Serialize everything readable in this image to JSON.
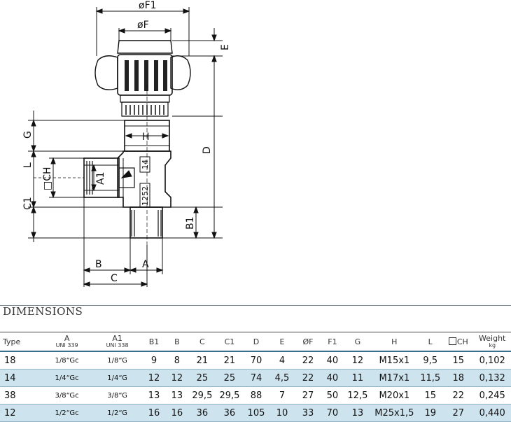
{
  "drawing": {
    "labels": {
      "F1": "øF1",
      "F": "øF",
      "E": "E",
      "G": "G",
      "H": "H",
      "L": "L",
      "CH": "□CH",
      "A1": "A1",
      "C1": "C1",
      "D": "D",
      "B1": "B1",
      "B": "B",
      "A": "A",
      "C": "C",
      "mark_14": "14",
      "mark_1252": "1252"
    }
  },
  "section": {
    "title": "DIMENSIONS"
  },
  "table": {
    "headers": [
      {
        "top": "Type",
        "sub": ""
      },
      {
        "top": "A",
        "sub": "UNI 339"
      },
      {
        "top": "A1",
        "sub": "UNI 338"
      },
      {
        "top": "B1",
        "sub": ""
      },
      {
        "top": "B",
        "sub": ""
      },
      {
        "top": "C",
        "sub": ""
      },
      {
        "top": "C1",
        "sub": ""
      },
      {
        "top": "D",
        "sub": ""
      },
      {
        "top": "E",
        "sub": ""
      },
      {
        "top": "ØF",
        "sub": ""
      },
      {
        "top": "F1",
        "sub": ""
      },
      {
        "top": "G",
        "sub": ""
      },
      {
        "top": "H",
        "sub": ""
      },
      {
        "top": "L",
        "sub": ""
      },
      {
        "top": "CH",
        "sub": ""
      },
      {
        "top": "Weight",
        "sub": "kg"
      }
    ],
    "rows": [
      [
        "18",
        "1/8“Gc",
        "1/8“G",
        "9",
        "8",
        "21",
        "21",
        "70",
        "4",
        "22",
        "40",
        "12",
        "M15x1",
        "9,5",
        "15",
        "0,102"
      ],
      [
        "14",
        "1/4“Gc",
        "1/4“G",
        "12",
        "12",
        "25",
        "25",
        "74",
        "4,5",
        "22",
        "40",
        "11",
        "M17x1",
        "11,5",
        "18",
        "0,132"
      ],
      [
        "38",
        "3/8“Gc",
        "3/8“G",
        "13",
        "13",
        "29,5",
        "29,5",
        "88",
        "7",
        "27",
        "50",
        "12,5",
        "M20x1",
        "15",
        "22",
        "0,245"
      ],
      [
        "12",
        "1/2“Gc",
        "1/2“G",
        "16",
        "16",
        "36",
        "36",
        "105",
        "10",
        "33",
        "70",
        "13",
        "M25x1,5",
        "19",
        "27",
        "0,440"
      ]
    ]
  }
}
